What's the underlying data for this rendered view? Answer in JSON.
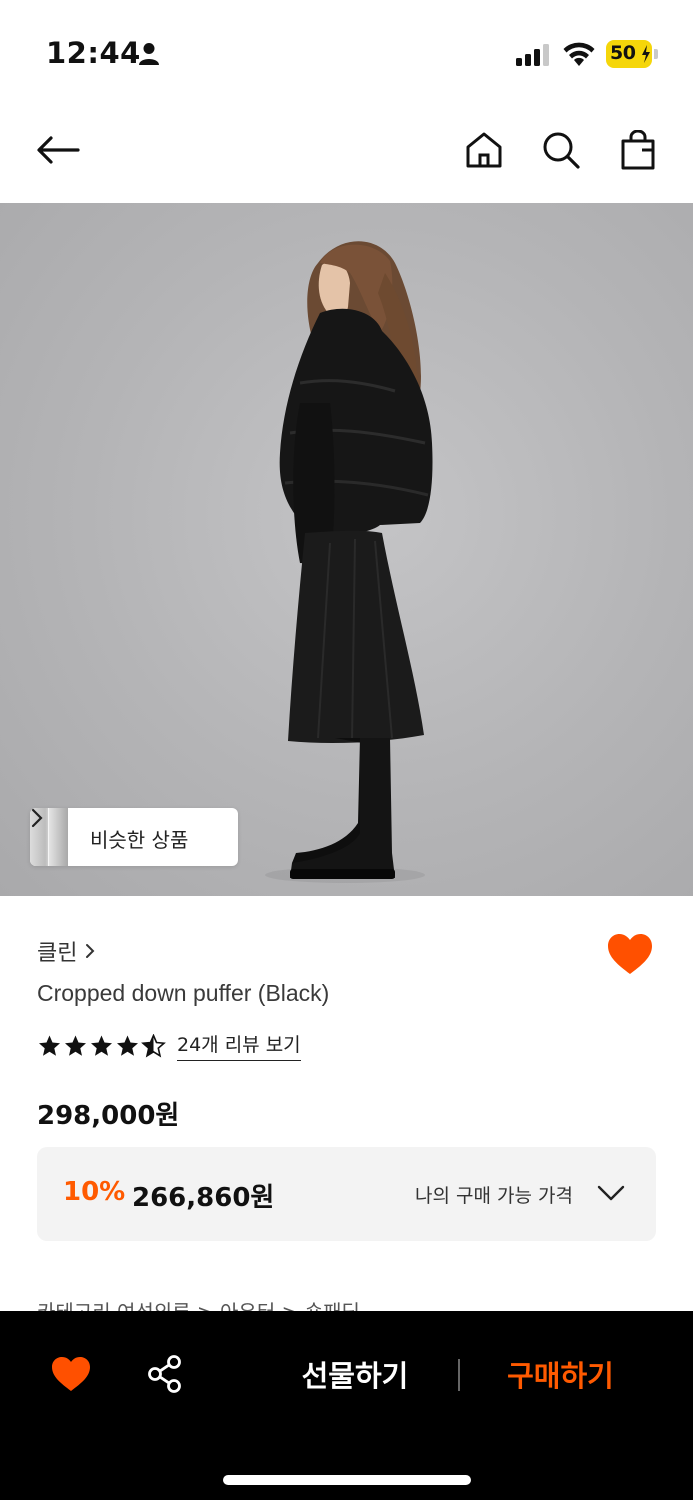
{
  "status_bar": {
    "time": "12:44",
    "battery": "50",
    "icons": [
      "person-icon",
      "signal-icon",
      "wifi-icon",
      "battery-charging-icon"
    ]
  },
  "nav": {
    "icons": [
      "arrow-left-icon",
      "home-icon",
      "search-icon",
      "shopping-bag-icon"
    ]
  },
  "product_image": {
    "similar_button_label": "비슷한 상품"
  },
  "product": {
    "brand": "클린",
    "name": "Cropped down puffer (Black)",
    "rating_stars": 4.5,
    "review_link": "24개 리뷰 보기",
    "price": "298,000원",
    "liked": true
  },
  "price_box": {
    "discount_rate": "10%",
    "discount_price": "266,860원",
    "my_price_label": "나의 구매 가능 가격"
  },
  "category_peek": "카테고리 여성의류 > 아우터 > 숏패딩",
  "bottom_bar": {
    "gift_label": "선물하기",
    "buy_label": "구매하기"
  },
  "colors": {
    "accent": "#ff5a00",
    "heart": "#ff5000",
    "battery": "#f5d60a",
    "bottom_bar": "#000000"
  }
}
